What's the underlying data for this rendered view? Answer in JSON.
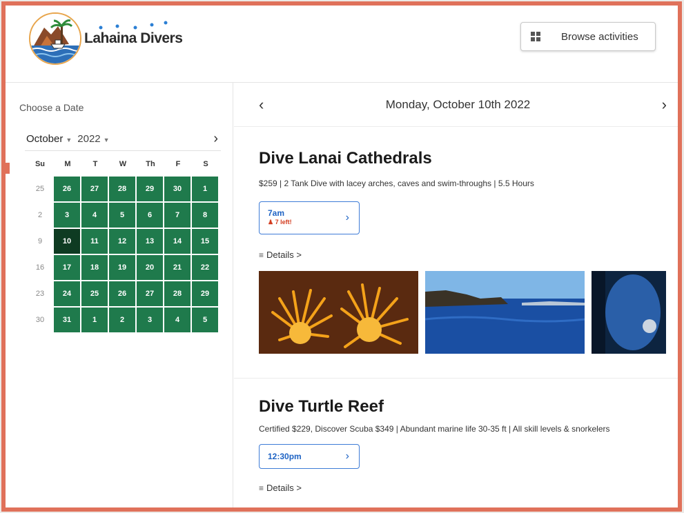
{
  "header": {
    "logo_text": "Lahaina Divers",
    "browse_label": "Browse activities"
  },
  "sidebar": {
    "choose_label": "Choose a Date",
    "month": "October",
    "year": "2022",
    "next_icon": "chevron-right-icon",
    "dow": [
      "Su",
      "M",
      "T",
      "W",
      "Th",
      "F",
      "S"
    ],
    "weeks": [
      {
        "wk": "25",
        "days": [
          "26",
          "27",
          "28",
          "29",
          "30",
          "1"
        ]
      },
      {
        "wk": "2",
        "days": [
          "3",
          "4",
          "5",
          "6",
          "7",
          "8"
        ]
      },
      {
        "wk": "9",
        "days": [
          "10",
          "11",
          "12",
          "13",
          "14",
          "15"
        ]
      },
      {
        "wk": "16",
        "days": [
          "17",
          "18",
          "19",
          "20",
          "21",
          "22"
        ]
      },
      {
        "wk": "23",
        "days": [
          "24",
          "25",
          "26",
          "27",
          "28",
          "29"
        ]
      },
      {
        "wk": "30",
        "days": [
          "31",
          "1",
          "2",
          "3",
          "4",
          "5"
        ]
      }
    ],
    "selected_day": "10",
    "day_color": "#1f7a4c",
    "selected_color": "#0e3b22"
  },
  "main": {
    "date_label": "Monday, October 10th 2022",
    "activities": [
      {
        "title": "Dive Lanai Cathedrals",
        "desc": "$259 | 2 Tank Dive with lacey arches, caves and swim-throughs | 5.5 Hours",
        "time": "7am",
        "spots": "7 left!",
        "details": "Details >"
      },
      {
        "title": "Dive Turtle Reef",
        "desc": "Certified $229, Discover Scuba $349 | Abundant marine life 30-35 ft | All skill levels & snorkelers",
        "time": "12:30pm",
        "details": "Details >"
      }
    ]
  },
  "colors": {
    "frame": "#e0715a",
    "link_blue": "#1e63c4",
    "alert_red": "#d23b1e"
  }
}
